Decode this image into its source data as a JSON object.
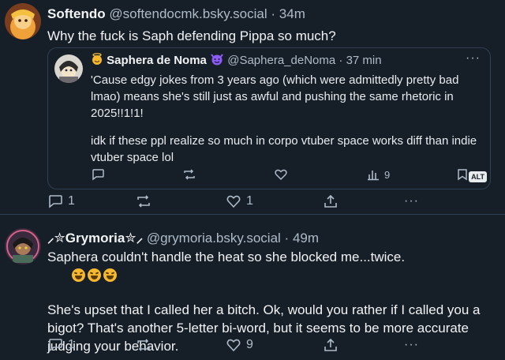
{
  "posts": [
    {
      "author_name": "Softendo",
      "handle": "@softendocmk.bsky.social",
      "separator": "·",
      "time": "34m",
      "text": "Why the fuck is Saph defending Pippa so much?",
      "quote": {
        "author_name": "Saphera de Noma",
        "handle": "@Saphera_deNoma",
        "separator": "·",
        "time": "37 min",
        "paragraph_1": "'Cause edgy jokes from 3 years ago (which were admittedly pretty bad lmao) means she's still just as awful and pushing the same rhetoric in 2025!!1!1!",
        "paragraph_2": "idk if these ppl realize so much in corpo vtuber space works diff than indie vtuber space lol",
        "views": "9",
        "alt_label": "ALT",
        "more": "···"
      },
      "reply_count": "1",
      "like_count": "1",
      "more": "···"
    },
    {
      "author_name": "⸝✮Grymoria✮⸝",
      "handle": "@grymoria.bsky.social",
      "separator": "·",
      "time": "49m",
      "paragraph_1": "Saphera couldn't handle the heat so she blocked me...twice.",
      "paragraph_2": "She's upset that I called her a bitch. Ok, would you rather if I called you a bigot? That's another 5-letter bi-word, but it seems to be more accurate judging your behavior.",
      "reply_count": "1",
      "like_count": "9",
      "more": "···"
    }
  ],
  "colors": {
    "background": "#161e27",
    "text": "#f1f3f5",
    "muted": "#aebbc9",
    "border": "#2e4052"
  },
  "icons": [
    "reply-icon",
    "repost-icon",
    "like-icon",
    "share-icon",
    "more-icon",
    "views-icon",
    "bookmark-icon",
    "laughing-emoji"
  ]
}
